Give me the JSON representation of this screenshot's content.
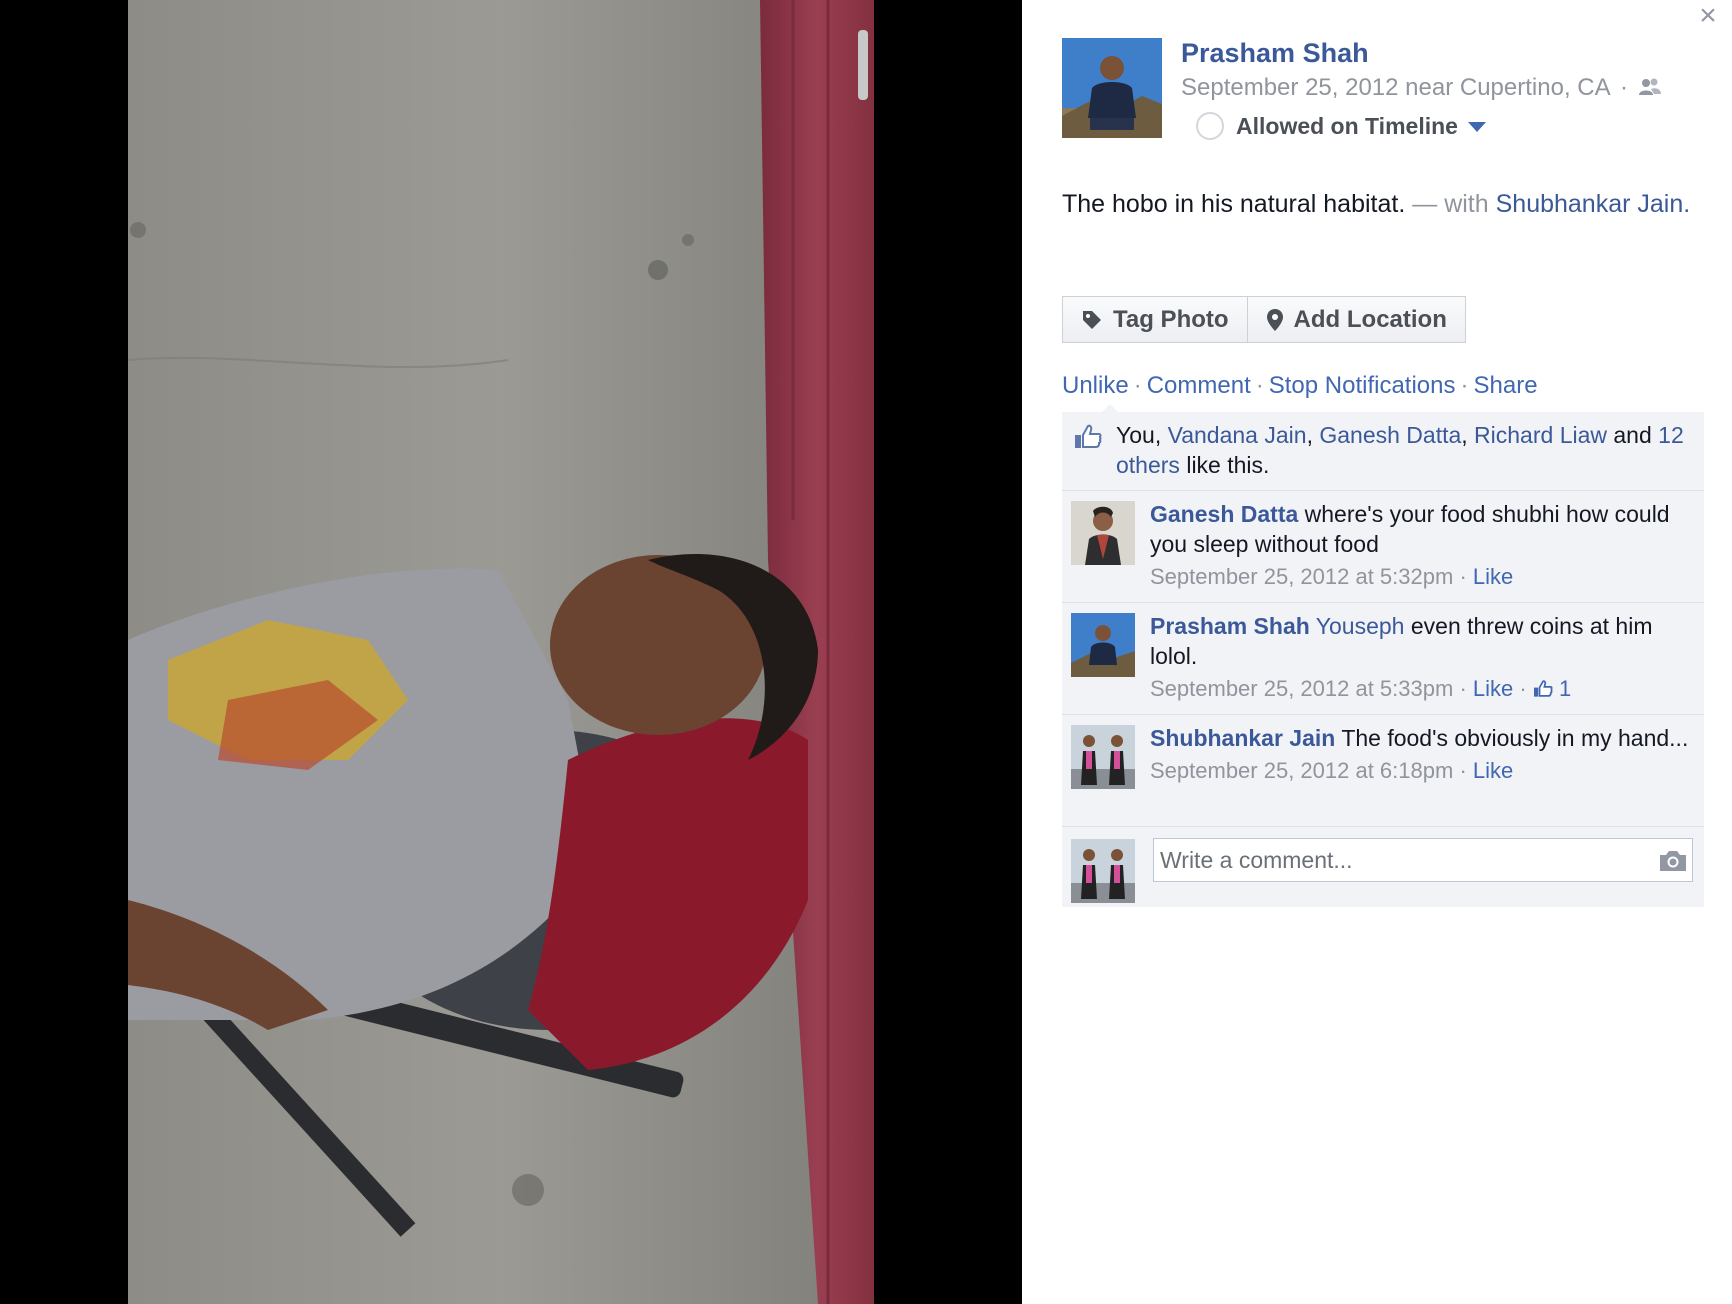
{
  "close_symbol": "×",
  "owner": {
    "name": "Prasham Shah",
    "date": "September 25, 2012",
    "near": "near Cupertino, CA",
    "meta_sep": "·",
    "audience_icon": "friends-icon"
  },
  "timeline": {
    "label": "Allowed on Timeline"
  },
  "caption": {
    "text": "The hobo in his natural habitat.",
    "with_prefix": "— with",
    "tagged": "Shubhankar Jain",
    "end": "."
  },
  "buttons": {
    "tag_photo": "Tag Photo",
    "add_location": "Add Location"
  },
  "actions": {
    "unlike": "Unlike",
    "comment": "Comment",
    "stop_notifications": "Stop Notifications",
    "share": "Share",
    "dot": "·"
  },
  "likes": {
    "you": "You,",
    "names": [
      "Vandana Jain",
      "Ganesh Datta",
      "Richard Liaw"
    ],
    "comma": ",",
    "and": "and",
    "others": "12 others",
    "suffix": "like this."
  },
  "comments": [
    {
      "author": "Ganesh Datta",
      "mention": "",
      "text": "where's your food shubhi how could you sleep without food",
      "time": "September 25, 2012 at 5:32pm",
      "like_label": "Like",
      "like_count": ""
    },
    {
      "author": "Prasham Shah",
      "mention": "Youseph",
      "text": "even threw coins at him lolol.",
      "time": "September 25, 2012 at 5:33pm",
      "like_label": "Like",
      "like_count": "1"
    },
    {
      "author": "Shubhankar Jain",
      "mention": "",
      "text": "The food's obviously in my hand...",
      "time": "September 25, 2012 at 6:18pm",
      "like_label": "Like",
      "like_count": ""
    }
  ],
  "compose": {
    "placeholder": "Write a comment...",
    "icon": "camera-icon"
  },
  "colors": {
    "link": "#3b5998",
    "muted": "#90949c",
    "ufi_bg": "#f2f3f7",
    "stage_bg": "#000000"
  }
}
